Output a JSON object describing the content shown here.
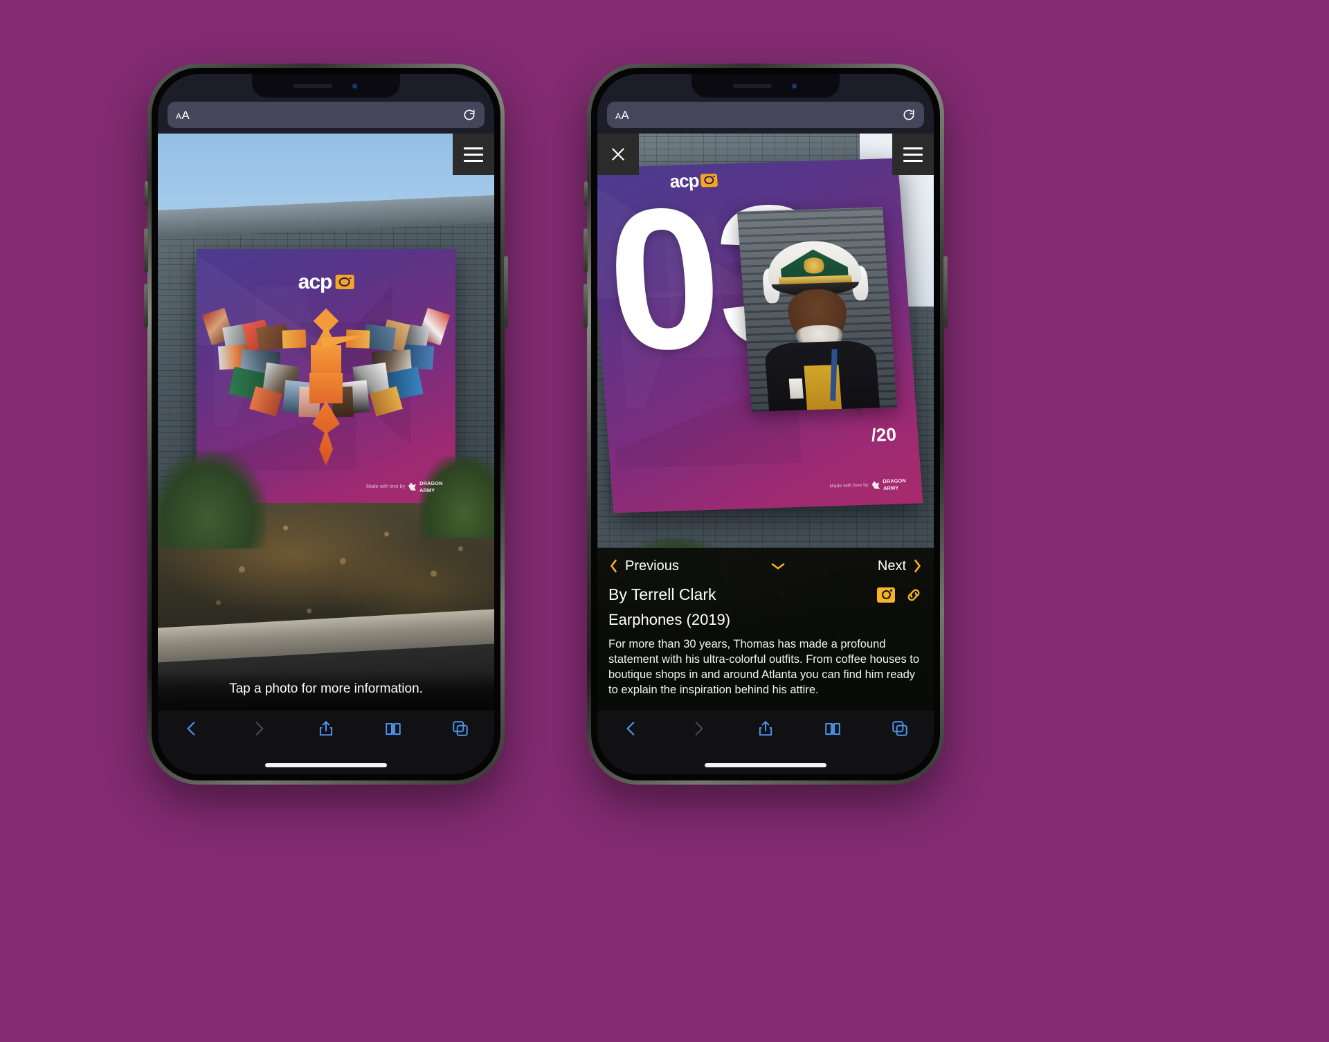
{
  "background_color": "#822b72",
  "accent_gold": "#f5b328",
  "browser": {
    "name": "safari-mobile",
    "address_bar": {
      "text_size_label": "AA",
      "text_size_small": "A",
      "text_size_large": "A",
      "reload_icon": "reload-icon"
    },
    "toolbar": {
      "back_icon": "back-chevron-icon",
      "forward_icon": "forward-chevron-icon",
      "share_icon": "share-icon",
      "bookmarks_icon": "book-icon",
      "tabs_icon": "tabs-icon"
    }
  },
  "left_phone": {
    "name": "gallery-overview-screen",
    "menu_icon": "hamburger-menu-icon",
    "caption": "Tap a photo for more information.",
    "mural": {
      "logo_word": "acp",
      "logo_camera_icon": "camera-icon",
      "credit_text": "Made with love by",
      "credit_brand_line1": "DRAGON",
      "credit_brand_line2": "ARMY",
      "credit_brand_icon": "dragon-icon"
    }
  },
  "right_phone": {
    "name": "artwork-detail-screen",
    "close_icon": "close-x-icon",
    "menu_icon": "hamburger-menu-icon",
    "mural": {
      "big_number": "03",
      "number_suffix": "/20",
      "logo_word": "acp",
      "logo_camera_icon": "camera-icon",
      "credit_text": "Made with love by",
      "credit_brand_line1": "DRAGON",
      "credit_brand_line2": "ARMY"
    },
    "detail": {
      "previous_label": "Previous",
      "previous_icon": "chevron-left-icon",
      "collapse_icon": "chevron-down-icon",
      "next_label": "Next",
      "next_icon": "chevron-right-icon",
      "byline": "By Terrell Clark",
      "camera_icon": "camera-icon",
      "link_icon": "link-icon",
      "artwork_title": "Earphones (2019)",
      "description": "For more than 30 years, Thomas has made a profound statement with his ultra-colorful outfits. From coffee houses to boutique shops in and around Atlanta you can find him ready to explain the inspiration behind his attire."
    }
  }
}
